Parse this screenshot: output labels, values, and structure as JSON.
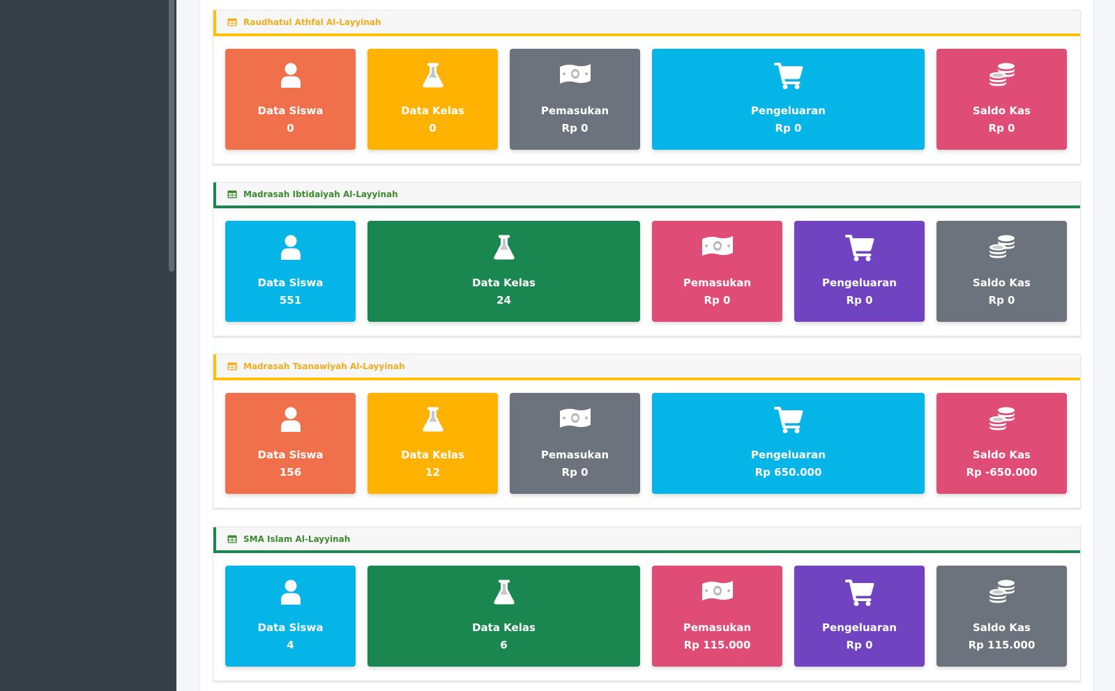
{
  "colors": {
    "orange": "#f1704c",
    "yellow": "#ffb300",
    "gray": "#6c737c",
    "cyan": "#06b5e8",
    "pink": "#df4c75",
    "green": "#1b8750",
    "purple": "#7043c0",
    "sidebar": "#343f47"
  },
  "panels": [
    {
      "title": "Raudhatul Athfal Al-Layyinah",
      "accent": "yellow",
      "tiles": [
        {
          "icon": "user-icon",
          "label": "Data Siswa",
          "value": "0",
          "color": "orange"
        },
        {
          "icon": "flask-icon",
          "label": "Data Kelas",
          "value": "0",
          "color": "yellow"
        },
        {
          "icon": "money-icon",
          "label": "Pemasukan",
          "value": "Rp 0",
          "color": "gray"
        },
        {
          "icon": "cart-icon",
          "label": "Pengeluaran",
          "value": "Rp 0",
          "color": "cyan"
        },
        {
          "icon": "coins-icon",
          "label": "Saldo Kas",
          "value": "Rp 0",
          "color": "pink"
        }
      ]
    },
    {
      "title": "Madrasah Ibtidaiyah Al-Layyinah",
      "accent": "green",
      "tiles": [
        {
          "icon": "user-icon",
          "label": "Data Siswa",
          "value": "551",
          "color": "cyan"
        },
        {
          "icon": "flask-icon",
          "label": "Data Kelas",
          "value": "24",
          "color": "green"
        },
        {
          "icon": "money-icon",
          "label": "Pemasukan",
          "value": "Rp 0",
          "color": "pink"
        },
        {
          "icon": "cart-icon",
          "label": "Pengeluaran",
          "value": "Rp 0",
          "color": "purple"
        },
        {
          "icon": "coins-icon",
          "label": "Saldo Kas",
          "value": "Rp 0",
          "color": "gray"
        }
      ]
    },
    {
      "title": "Madrasah Tsanawiyah Al-Layyinah",
      "accent": "yellow",
      "tiles": [
        {
          "icon": "user-icon",
          "label": "Data Siswa",
          "value": "156",
          "color": "orange"
        },
        {
          "icon": "flask-icon",
          "label": "Data Kelas",
          "value": "12",
          "color": "yellow"
        },
        {
          "icon": "money-icon",
          "label": "Pemasukan",
          "value": "Rp 0",
          "color": "gray"
        },
        {
          "icon": "cart-icon",
          "label": "Pengeluaran",
          "value": "Rp 650.000",
          "color": "cyan"
        },
        {
          "icon": "coins-icon",
          "label": "Saldo Kas",
          "value": "Rp -650.000",
          "color": "pink"
        }
      ]
    },
    {
      "title": "SMA Islam Al-Layyinah",
      "accent": "green",
      "tiles": [
        {
          "icon": "user-icon",
          "label": "Data Siswa",
          "value": "4",
          "color": "cyan"
        },
        {
          "icon": "flask-icon",
          "label": "Data Kelas",
          "value": "6",
          "color": "green"
        },
        {
          "icon": "money-icon",
          "label": "Pemasukan",
          "value": "Rp 115.000",
          "color": "pink"
        },
        {
          "icon": "cart-icon",
          "label": "Pengeluaran",
          "value": "Rp 0",
          "color": "purple"
        },
        {
          "icon": "coins-icon",
          "label": "Saldo Kas",
          "value": "Rp 115.000",
          "color": "gray"
        }
      ]
    }
  ]
}
